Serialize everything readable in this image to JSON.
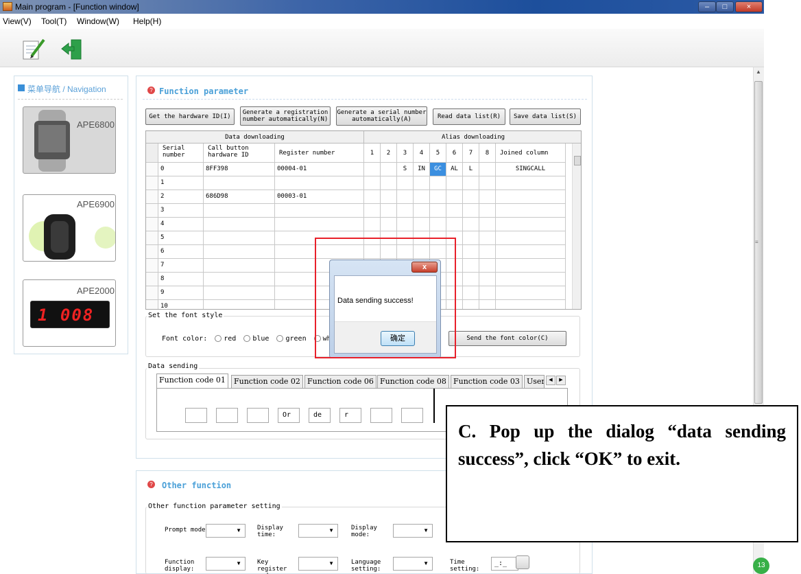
{
  "window": {
    "title": "Main program - [Function window]",
    "min_label": "–",
    "max_label": "□",
    "close_label": "×"
  },
  "menu": [
    "View(V)",
    "Tool(T)",
    "Window(W)",
    "Help(H)"
  ],
  "nav": {
    "title": "菜单导航 / Navigation",
    "cards": [
      "APE6800",
      "APE6900",
      "APE2000"
    ],
    "ape2000_display": "1 008"
  },
  "function_panel": {
    "title": "Function parameter",
    "buttons": {
      "hardware_id": "Get the hardware ID(I)",
      "gen_reg": "Generate a registration number automatically(N)",
      "gen_serial": "Generate a serial number automatically(A)",
      "read_list": "Read data list(R)",
      "save_list": "Save data list(S)"
    },
    "section_headers": {
      "data": "Data downloading",
      "alias": "Alias downloading"
    },
    "columns": [
      "Serial number",
      "Call button hardware ID",
      "Register number",
      "1",
      "2",
      "3",
      "4",
      "5",
      "6",
      "7",
      "8",
      "Joined column"
    ],
    "rows": [
      {
        "serial": "0",
        "hw": "8FF398",
        "reg": "00004-01",
        "a": [
          "",
          "",
          "S",
          "IN",
          "GC",
          "AL",
          "L",
          ""
        ],
        "joined": "SINGCALL"
      },
      {
        "serial": "1",
        "hw": "",
        "reg": "",
        "a": [
          "",
          "",
          "",
          "",
          "",
          "",
          "",
          ""
        ],
        "joined": ""
      },
      {
        "serial": "2",
        "hw": "686D98",
        "reg": "00003-01",
        "a": [
          "",
          "",
          "",
          "",
          "",
          "",
          "",
          ""
        ],
        "joined": ""
      },
      {
        "serial": "3",
        "hw": "",
        "reg": "",
        "a": [
          "",
          "",
          "",
          "",
          "",
          "",
          "",
          ""
        ],
        "joined": ""
      },
      {
        "serial": "4",
        "hw": "",
        "reg": "",
        "a": [
          "",
          "",
          "",
          "",
          "",
          "",
          "",
          ""
        ],
        "joined": ""
      },
      {
        "serial": "5",
        "hw": "",
        "reg": "",
        "a": [
          "",
          "",
          "",
          "",
          "",
          "",
          "",
          ""
        ],
        "joined": ""
      },
      {
        "serial": "6",
        "hw": "",
        "reg": "",
        "a": [
          "",
          "",
          "",
          "",
          "",
          "",
          "",
          ""
        ],
        "joined": ""
      },
      {
        "serial": "7",
        "hw": "",
        "reg": "",
        "a": [
          "",
          "",
          "",
          "",
          "",
          "",
          "",
          ""
        ],
        "joined": ""
      },
      {
        "serial": "8",
        "hw": "",
        "reg": "",
        "a": [
          "",
          "",
          "",
          "",
          "",
          "",
          "",
          ""
        ],
        "joined": ""
      },
      {
        "serial": "9",
        "hw": "",
        "reg": "",
        "a": [
          "",
          "",
          "",
          "",
          "",
          "",
          "",
          ""
        ],
        "joined": ""
      },
      {
        "serial": "10",
        "hw": "",
        "reg": "",
        "a": [
          "",
          "",
          "",
          "",
          "",
          "",
          "",
          ""
        ],
        "joined": ""
      }
    ],
    "highlight_color": "#3b8fe0",
    "font_style": {
      "title": "Set the font style",
      "label": "Font color:",
      "options": [
        "red",
        "blue",
        "green",
        "white"
      ],
      "send_button": "Send the font color(C)"
    },
    "data_sending": {
      "title": "Data sending",
      "tabs": [
        "Function code 01",
        "Function code 02",
        "Function code 06",
        "Function code 08",
        "Function code 03",
        "User"
      ],
      "boxes": [
        "",
        "",
        "",
        "Or",
        "de",
        "r",
        "",
        ""
      ]
    }
  },
  "other_panel": {
    "title": "Other function",
    "group": "Other function parameter setting",
    "labels": {
      "prompt": "Prompt mode:",
      "display_time": "Display time:",
      "display_mode": "Display mode:",
      "function_display": "Function display:",
      "key_register": "Key register mode:",
      "language": "Language setting:",
      "time_setting": "Time setting:"
    },
    "time_value": "_:_"
  },
  "dialog": {
    "message": "Data sending success!",
    "ok": "确定",
    "close": "x"
  },
  "callout": {
    "text": "C. Pop up the dialog “data sending success”, click “OK” to exit."
  },
  "misc": {
    "corner_badge": "13"
  }
}
